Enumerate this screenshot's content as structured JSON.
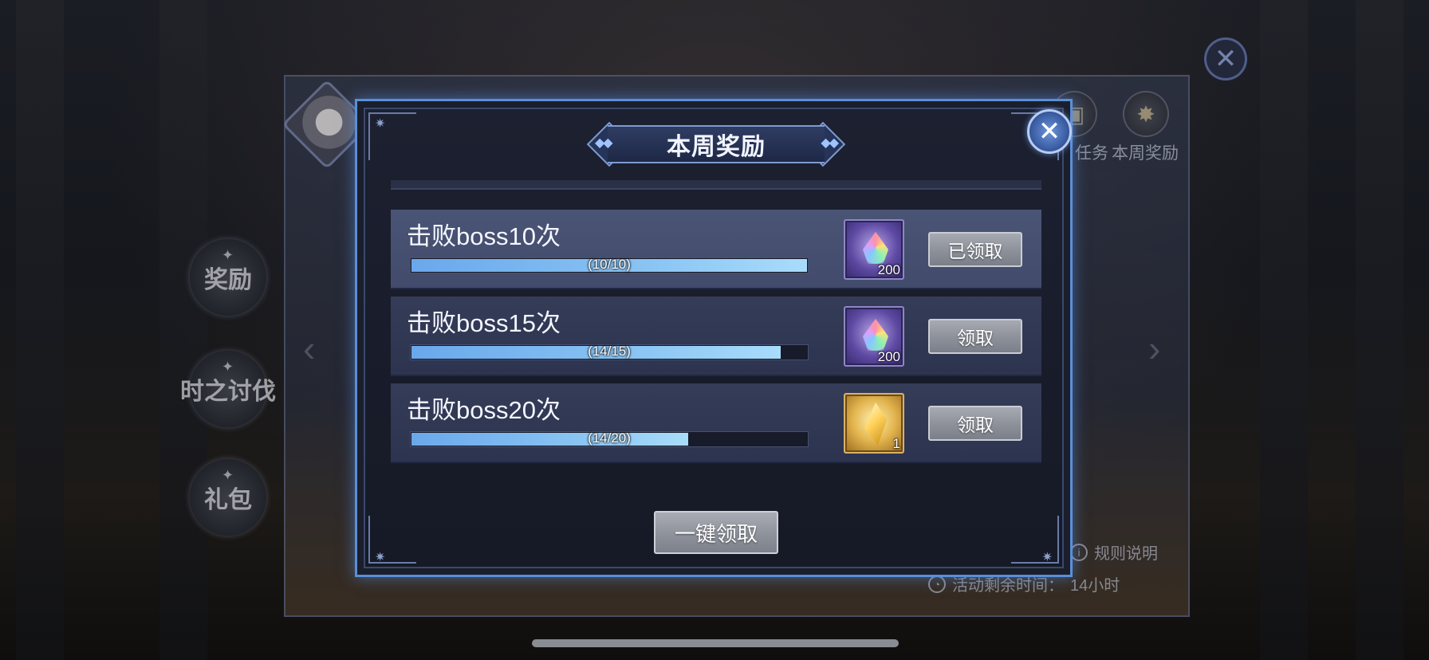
{
  "background": {
    "side_menu": [
      "奖励",
      "时之讨伐",
      "礼包"
    ],
    "top_tabs": [
      {
        "label": "任务",
        "icon": "task-icon"
      },
      {
        "label": "本周奖励",
        "icon": "weekly-reward-icon"
      }
    ],
    "rules_label": "规则说明",
    "remaining_time_label": "活动剩余时间：",
    "remaining_time_value": "14小时"
  },
  "dialog": {
    "title": "本周奖励",
    "close_icon": "close-icon",
    "tasks": [
      {
        "label": "击败boss10次",
        "progress_text": "(10/10)",
        "current": 10,
        "target": 10,
        "reward_icon": "rainbow-gem-icon",
        "reward_qty": "200",
        "button_label": "已领取",
        "claimed": true
      },
      {
        "label": "击败boss15次",
        "progress_text": "(14/15)",
        "current": 14,
        "target": 15,
        "reward_icon": "rainbow-gem-icon",
        "reward_qty": "200",
        "button_label": "领取",
        "claimed": false
      },
      {
        "label": "击败boss20次",
        "progress_text": "(14/20)",
        "current": 14,
        "target": 20,
        "reward_icon": "gold-crystal-icon",
        "reward_qty": "1",
        "button_label": "领取",
        "claimed": false
      }
    ],
    "claim_all_label": "一键领取"
  },
  "colors": {
    "dialog_border": "#5a8fd8",
    "progress_fill": "#89c4f3",
    "button_gray": "#8c9099"
  }
}
